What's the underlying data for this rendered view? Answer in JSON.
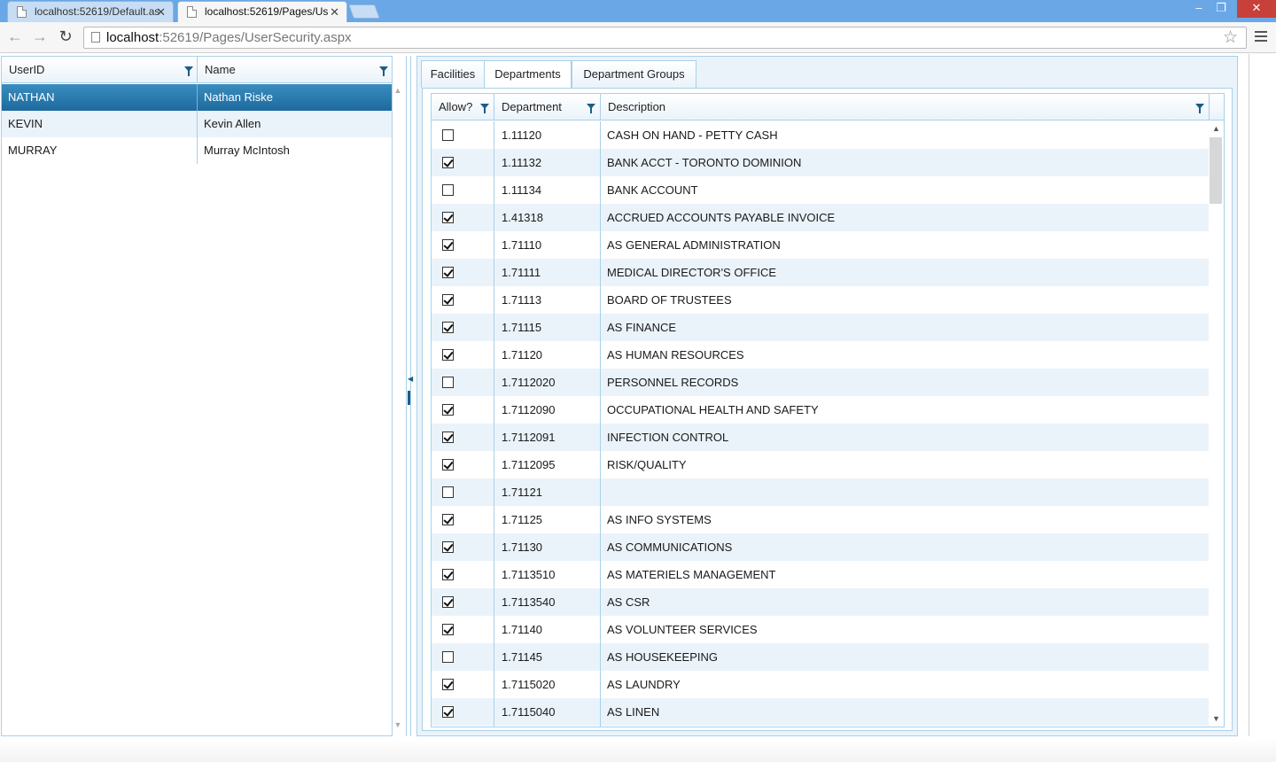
{
  "browser": {
    "tabs": [
      {
        "title": "localhost:52619/Default.as",
        "active": false
      },
      {
        "title": "localhost:52619/Pages/Us",
        "active": true
      }
    ],
    "tab_close": "✕",
    "url_host": "localhost",
    "url_path": ":52619/Pages/UserSecurity.aspx",
    "controls": {
      "minimize": "–",
      "restore": "❐",
      "close": "✕"
    },
    "nav": {
      "back": "←",
      "forward": "→",
      "reload": "↻"
    },
    "star": "☆"
  },
  "users": {
    "columns": [
      "UserID",
      "Name"
    ],
    "rows": [
      {
        "userid": "NATHAN",
        "name": "Nathan Riske",
        "selected": true
      },
      {
        "userid": "KEVIN",
        "name": "Kevin Allen",
        "selected": false
      },
      {
        "userid": "MURRAY",
        "name": "Murray McIntosh",
        "selected": false
      }
    ]
  },
  "tabs": [
    {
      "label": "Facilities",
      "active": false
    },
    {
      "label": "Departments",
      "active": true
    },
    {
      "label": "Department Groups",
      "active": false
    }
  ],
  "departments": {
    "columns": [
      "Allow?",
      "Department",
      "Description"
    ],
    "rows": [
      {
        "allow": false,
        "dept": "1.11120",
        "desc": "CASH ON HAND - PETTY CASH"
      },
      {
        "allow": true,
        "dept": "1.11132",
        "desc": "BANK ACCT - TORONTO DOMINION"
      },
      {
        "allow": false,
        "dept": "1.11134",
        "desc": "BANK ACCOUNT"
      },
      {
        "allow": true,
        "dept": "1.41318",
        "desc": "ACCRUED ACCOUNTS PAYABLE INVOICE"
      },
      {
        "allow": true,
        "dept": "1.71110",
        "desc": "AS GENERAL ADMINISTRATION"
      },
      {
        "allow": true,
        "dept": "1.71111",
        "desc": "MEDICAL DIRECTOR'S OFFICE"
      },
      {
        "allow": true,
        "dept": "1.71113",
        "desc": "BOARD OF TRUSTEES"
      },
      {
        "allow": true,
        "dept": "1.71115",
        "desc": "AS FINANCE"
      },
      {
        "allow": true,
        "dept": "1.71120",
        "desc": "AS HUMAN RESOURCES"
      },
      {
        "allow": false,
        "dept": "1.7112020",
        "desc": "PERSONNEL RECORDS"
      },
      {
        "allow": true,
        "dept": "1.7112090",
        "desc": "OCCUPATIONAL HEALTH AND SAFETY"
      },
      {
        "allow": true,
        "dept": "1.7112091",
        "desc": "INFECTION CONTROL"
      },
      {
        "allow": true,
        "dept": "1.7112095",
        "desc": "RISK/QUALITY"
      },
      {
        "allow": false,
        "dept": "1.71121",
        "desc": ""
      },
      {
        "allow": true,
        "dept": "1.71125",
        "desc": "AS INFO SYSTEMS"
      },
      {
        "allow": true,
        "dept": "1.71130",
        "desc": "AS COMMUNICATIONS"
      },
      {
        "allow": true,
        "dept": "1.7113510",
        "desc": "AS MATERIELS MANAGEMENT"
      },
      {
        "allow": true,
        "dept": "1.7113540",
        "desc": "AS CSR"
      },
      {
        "allow": true,
        "dept": "1.71140",
        "desc": "AS VOLUNTEER SERVICES"
      },
      {
        "allow": false,
        "dept": "1.71145",
        "desc": "AS HOUSEKEEPING"
      },
      {
        "allow": true,
        "dept": "1.7115020",
        "desc": "AS LAUNDRY"
      },
      {
        "allow": true,
        "dept": "1.7115040",
        "desc": "AS LINEN"
      }
    ]
  },
  "colors": {
    "accent": "#1d6a9e",
    "grid_border": "#a9d0e9",
    "alt_row": "#eaf3fa",
    "titlebar": "#6aa7e6"
  }
}
